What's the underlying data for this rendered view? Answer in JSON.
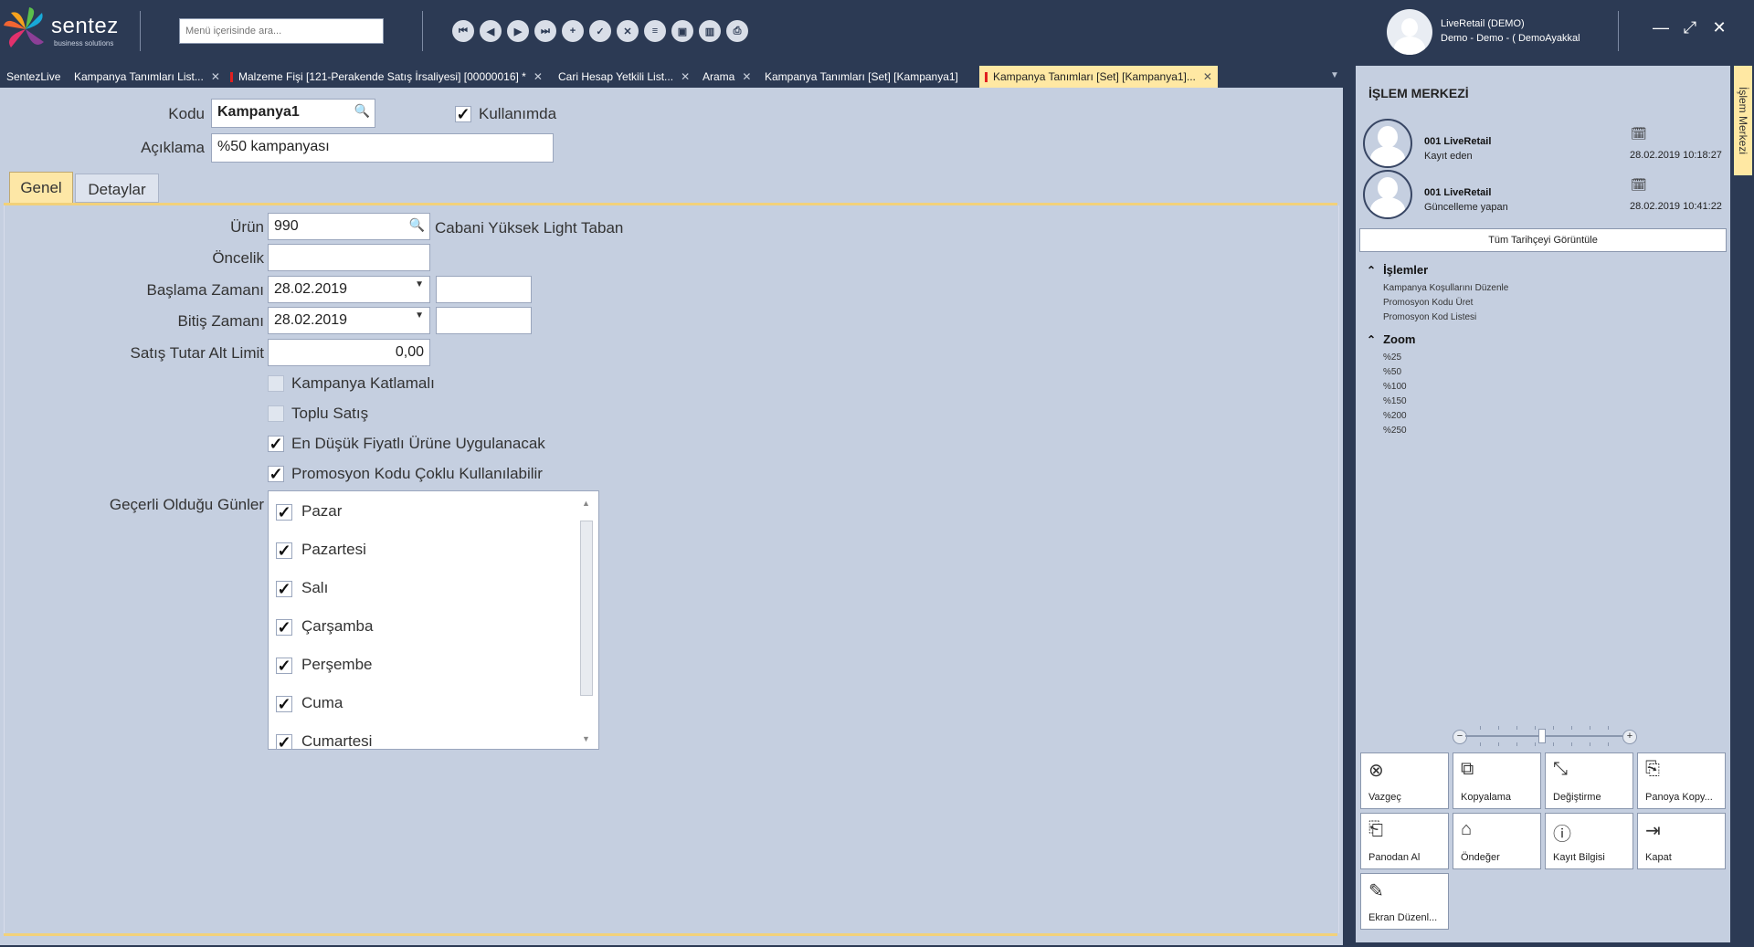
{
  "app": {
    "brand": "sentez",
    "tagline": "business solutions",
    "search_placeholder": "Menü içerisinde ara...",
    "user_name": "LiveRetail (DEMO)",
    "user_sub": "Demo - Demo - ( DemoAyakkal"
  },
  "toolbar": {
    "buttons": [
      "first-icon",
      "prev-icon",
      "next-icon",
      "last-icon",
      "add-icon",
      "save-icon",
      "delete-icon",
      "list-icon",
      "preview-icon",
      "trash-icon",
      "print-icon"
    ]
  },
  "tabs": [
    {
      "label": "SentezLive",
      "closable": false
    },
    {
      "label": "Kampanya Tanımları List...",
      "closable": true
    },
    {
      "label": "Malzeme Fişi [121-Perakende Satış İrsaliyesi]  [00000016]  *",
      "closable": true
    },
    {
      "label": "Cari Hesap Yetkili List...",
      "closable": true
    },
    {
      "label": "Arama",
      "closable": true
    },
    {
      "label": "Kampanya Tanımları  [Set] [Kampanya1]",
      "closable": false
    },
    {
      "label": "Kampanya Tanımları  [Set] [Kampanya1]...",
      "closable": true
    }
  ],
  "form": {
    "kodu_label": "Kodu",
    "kodu_value": "Kampanya1",
    "kullanimda_label": "Kullanımda",
    "aciklama_label": "Açıklama",
    "aciklama_value": "%50 kampanyası",
    "tab_genel": "Genel",
    "tab_detaylar": "Detaylar",
    "urun_label": "Ürün",
    "urun_value": "990",
    "urun_desc": "Cabani Yüksek Light Taban",
    "oncelik_label": "Öncelik",
    "oncelik_value": "",
    "baslama_label": "Başlama Zamanı",
    "baslama_date": "28.02.2019",
    "baslama_time": "",
    "bitis_label": "Bitiş Zamanı",
    "bitis_date": "28.02.2019",
    "bitis_time": "",
    "satis_label": "Satış Tutar Alt Limit",
    "satis_value": "0,00",
    "cb_katlamali": "Kampanya Katlamalı",
    "cb_toplu": "Toplu Satış",
    "cb_endusuk": "En Düşük Fiyatlı Ürüne Uygulanacak",
    "cb_promosyon": "Promosyon Kodu Çoklu Kullanılabilir",
    "gunler_label": "Geçerli Olduğu Günler",
    "days": [
      "Pazar",
      "Pazartesi",
      "Salı",
      "Çarşamba",
      "Perşembe",
      "Cuma",
      "Cumartesi"
    ]
  },
  "right": {
    "title": "İŞLEM MERKEZİ",
    "side_tab": "İşlem Merkezi",
    "rec1_name": "001 LiveRetail",
    "rec1_role": "Kayıt eden",
    "rec1_date": "28.02.2019 10:18:27",
    "rec2_name": "001 LiveRetail",
    "rec2_role": "Güncelleme yapan",
    "rec2_date": "28.02.2019 10:41:22",
    "history_btn": "Tüm Tarihçeyi Görüntüle",
    "islemler_title": "İşlemler",
    "islemler": [
      "Kampanya Koşullarını Düzenle",
      "Promosyon Kodu Üret",
      "Promosyon Kod Listesi"
    ],
    "zoom_title": "Zoom",
    "zoom": [
      "%25",
      "%50",
      "%100",
      "%150",
      "%200",
      "%250"
    ],
    "actions": [
      "Vazgeç",
      "Kopyalama",
      "Değiştirme",
      "Panoya Kopy...",
      "Panodan Al",
      "Öndeğer",
      "Kayıt Bilgisi",
      "Kapat",
      "Ekran Düzenl..."
    ]
  }
}
